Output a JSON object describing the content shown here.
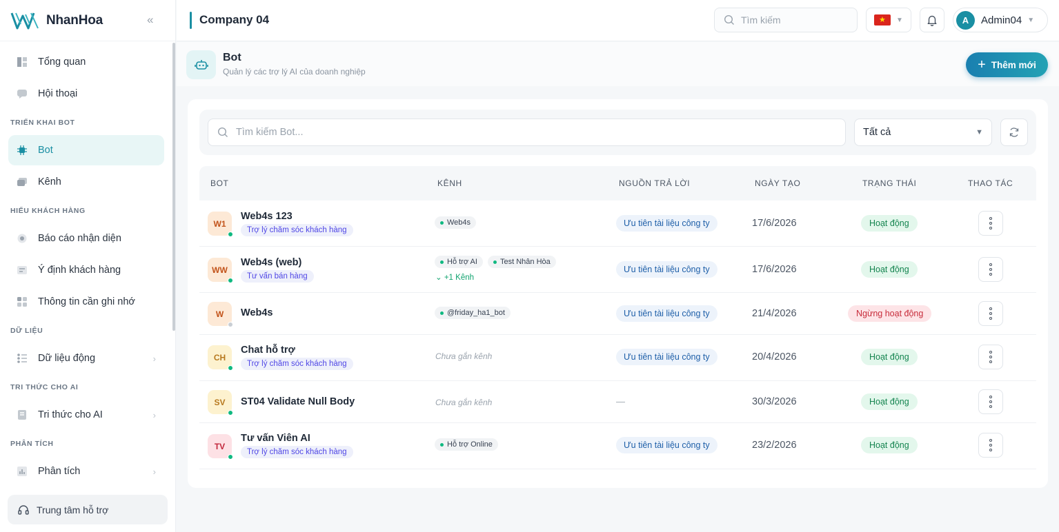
{
  "brand": {
    "name": "NhanHoa",
    "collapse_icon": "double-chevron-left-icon"
  },
  "sidebar": {
    "items_top": [
      {
        "label": "Tổng quan",
        "icon": "dashboard-icon"
      },
      {
        "label": "Hội thoại",
        "icon": "chat-icon"
      }
    ],
    "sections": [
      {
        "title": "TRIỂN KHAI BOT",
        "items": [
          {
            "label": "Bot",
            "icon": "bot-chip-icon",
            "active": true
          },
          {
            "label": "Kênh",
            "icon": "channel-icon"
          }
        ]
      },
      {
        "title": "HIỂU KHÁCH HÀNG",
        "items": [
          {
            "label": "Báo cáo nhận diện",
            "icon": "target-icon"
          },
          {
            "label": "Ý định khách hàng",
            "icon": "intent-icon"
          },
          {
            "label": "Thông tin cần ghi nhớ",
            "icon": "grid-icon"
          }
        ]
      },
      {
        "title": "DỮ LIỆU",
        "items": [
          {
            "label": "Dữ liệu động",
            "icon": "data-icon",
            "chevron": true
          }
        ]
      },
      {
        "title": "TRI THỨC CHO AI",
        "items": [
          {
            "label": "Tri thức cho AI",
            "icon": "book-icon",
            "chevron": true
          }
        ]
      },
      {
        "title": "PHÂN TÍCH",
        "items": [
          {
            "label": "Phân tích",
            "icon": "bar-chart-icon",
            "chevron": true
          }
        ]
      }
    ],
    "support_label": "Trung tâm hỗ trợ"
  },
  "header": {
    "company": "Company 04",
    "search_placeholder": "Tìm kiếm",
    "language_flag": "vietnam-flag-icon",
    "user_initial": "A",
    "user_name": "Admin04"
  },
  "page": {
    "title": "Bot",
    "subtitle": "Quản lý các trợ lý AI của doanh nghiệp",
    "add_button": "Thêm mới"
  },
  "filters": {
    "search_placeholder": "Tìm kiếm Bot...",
    "status_select": "Tất cả"
  },
  "table": {
    "columns": [
      "BOT",
      "KÊNH",
      "NGUỒN TRẢ LỜI",
      "NGÀY TẠO",
      "TRẠNG THÁI",
      "THAO TÁC"
    ],
    "rows": [
      {
        "initials": "W1",
        "name": "Web4s 123",
        "tag": "Trợ lý chăm sóc khách hàng",
        "online": true,
        "channels": [
          "Web4s"
        ],
        "more": "",
        "source": "Ưu tiên tài liệu công ty",
        "date": "17/6/2026",
        "status": "Hoạt động",
        "active": true
      },
      {
        "initials": "WW",
        "name": "Web4s (web)",
        "tag": "Tư vấn bán hàng",
        "online": true,
        "channels": [
          "Hỗ trợ AI",
          "Test Nhân Hòa"
        ],
        "more": "+1 Kênh",
        "source": "Ưu tiên tài liệu công ty",
        "date": "17/6/2026",
        "status": "Hoạt động",
        "active": true
      },
      {
        "initials": "W",
        "name": "Web4s",
        "tag": "",
        "online": false,
        "channels": [
          "@friday_ha1_bot"
        ],
        "more": "",
        "source": "Ưu tiên tài liệu công ty",
        "date": "21/4/2026",
        "status": "Ngừng hoạt động",
        "active": false
      },
      {
        "initials": "CH",
        "name": "Chat hỗ trợ",
        "tag": "Trợ lý chăm sóc khách hàng",
        "online": true,
        "channels": [],
        "no_channel": "Chưa gắn kênh",
        "more": "",
        "source": "Ưu tiên tài liệu công ty",
        "date": "20/4/2026",
        "status": "Hoạt động",
        "active": true
      },
      {
        "initials": "SV",
        "name": "ST04 Validate Null Body",
        "tag": "",
        "online": true,
        "channels": [],
        "no_channel": "Chưa gắn kênh",
        "more": "",
        "source": "—",
        "date": "30/3/2026",
        "status": "Hoạt động",
        "active": true
      },
      {
        "initials": "TV",
        "name": "Tư vấn Viên AI",
        "tag": "Trợ lý chăm sóc khách hàng",
        "online": true,
        "channels": [
          "Hỗ trợ Online"
        ],
        "more": "",
        "source": "Ưu tiên tài liệu công ty",
        "date": "23/2/2026",
        "status": "Hoạt động",
        "active": true
      }
    ]
  },
  "colors": {
    "accent": "#1a8fa3",
    "online": "#10b981",
    "offline": "#c9ced4"
  }
}
